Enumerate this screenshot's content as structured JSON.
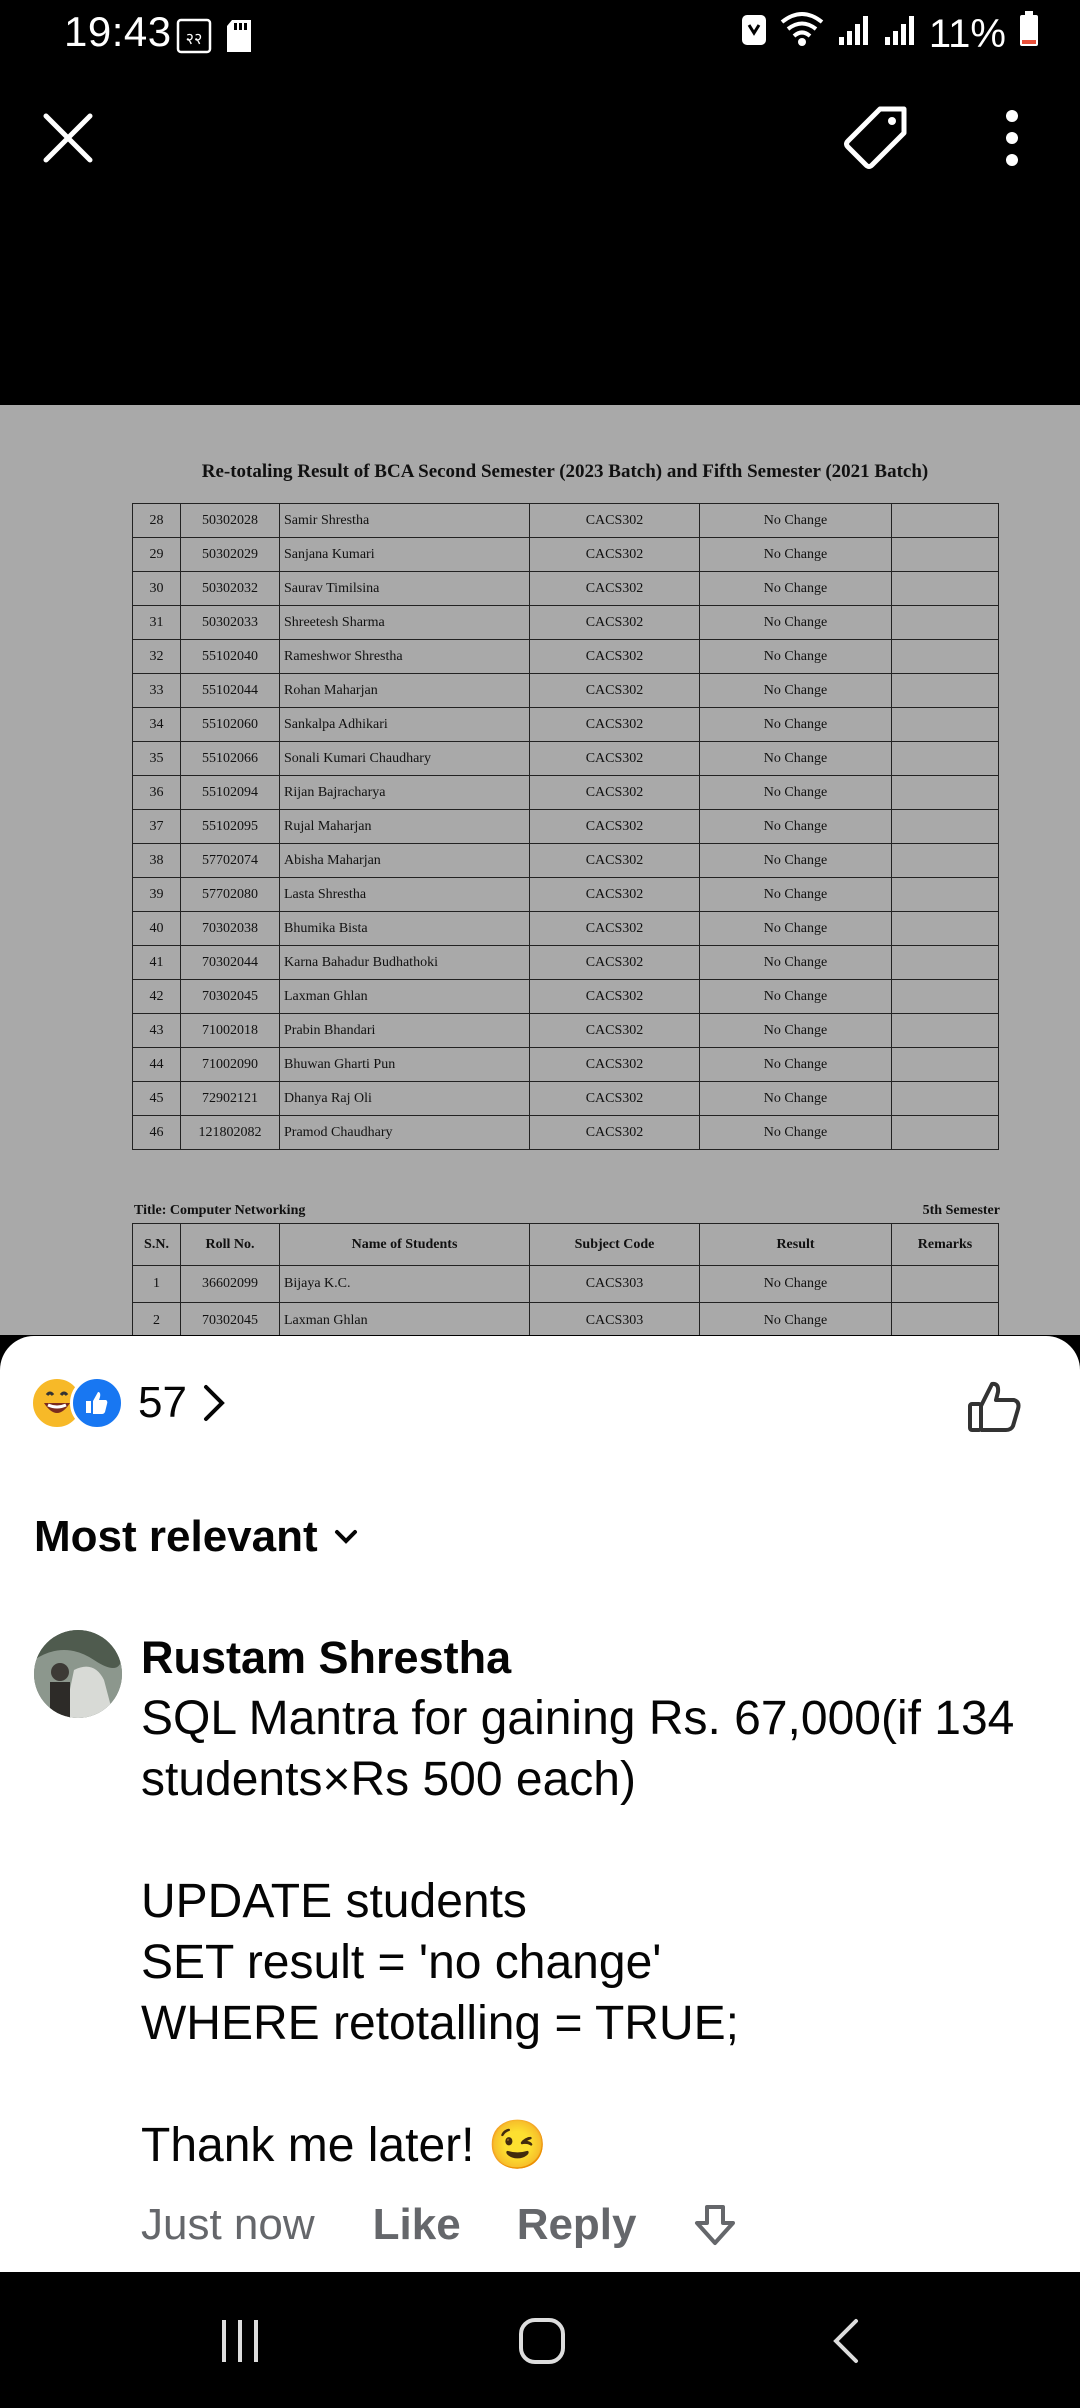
{
  "status_bar": {
    "time": "19:43",
    "notification_icons": [
      "calendar-22-icon",
      "sd-card-icon"
    ],
    "right_icons": [
      "nfc-icon",
      "wifi-icon",
      "signal-icon",
      "signal-icon"
    ],
    "battery_percent": "11%",
    "battery_level": 0.11
  },
  "top_bar": {
    "icons": [
      "close-icon",
      "tag-icon",
      "more-vert-icon"
    ]
  },
  "document": {
    "title": "Re-totaling Result of BCA Second Semester (2023 Batch) and Fifth Semester (2021 Batch)",
    "rows": [
      {
        "sn": "28",
        "roll": "50302028",
        "name": "Samir Shrestha",
        "code": "CACS302",
        "result": "No Change",
        "remarks": ""
      },
      {
        "sn": "29",
        "roll": "50302029",
        "name": "Sanjana Kumari",
        "code": "CACS302",
        "result": "No Change",
        "remarks": ""
      },
      {
        "sn": "30",
        "roll": "50302032",
        "name": "Saurav Timilsina",
        "code": "CACS302",
        "result": "No Change",
        "remarks": ""
      },
      {
        "sn": "31",
        "roll": "50302033",
        "name": "Shreetesh Sharma",
        "code": "CACS302",
        "result": "No Change",
        "remarks": ""
      },
      {
        "sn": "32",
        "roll": "55102040",
        "name": "Rameshwor Shrestha",
        "code": "CACS302",
        "result": "No Change",
        "remarks": ""
      },
      {
        "sn": "33",
        "roll": "55102044",
        "name": "Rohan Maharjan",
        "code": "CACS302",
        "result": "No Change",
        "remarks": ""
      },
      {
        "sn": "34",
        "roll": "55102060",
        "name": "Sankalpa Adhikari",
        "code": "CACS302",
        "result": "No Change",
        "remarks": ""
      },
      {
        "sn": "35",
        "roll": "55102066",
        "name": "Sonali Kumari Chaudhary",
        "code": "CACS302",
        "result": "No Change",
        "remarks": ""
      },
      {
        "sn": "36",
        "roll": "55102094",
        "name": "Rijan Bajracharya",
        "code": "CACS302",
        "result": "No Change",
        "remarks": ""
      },
      {
        "sn": "37",
        "roll": "55102095",
        "name": "Rujal Maharjan",
        "code": "CACS302",
        "result": "No Change",
        "remarks": ""
      },
      {
        "sn": "38",
        "roll": "57702074",
        "name": "Abisha Maharjan",
        "code": "CACS302",
        "result": "No Change",
        "remarks": ""
      },
      {
        "sn": "39",
        "roll": "57702080",
        "name": "Lasta Shrestha",
        "code": "CACS302",
        "result": "No Change",
        "remarks": ""
      },
      {
        "sn": "40",
        "roll": "70302038",
        "name": "Bhumika Bista",
        "code": "CACS302",
        "result": "No Change",
        "remarks": ""
      },
      {
        "sn": "41",
        "roll": "70302044",
        "name": "Karna Bahadur Budhathoki",
        "code": "CACS302",
        "result": "No Change",
        "remarks": ""
      },
      {
        "sn": "42",
        "roll": "70302045",
        "name": "Laxman Ghlan",
        "code": "CACS302",
        "result": "No Change",
        "remarks": ""
      },
      {
        "sn": "43",
        "roll": "71002018",
        "name": "Prabin Bhandari",
        "code": "CACS302",
        "result": "No Change",
        "remarks": ""
      },
      {
        "sn": "44",
        "roll": "71002090",
        "name": "Bhuwan Gharti Pun",
        "code": "CACS302",
        "result": "No Change",
        "remarks": ""
      },
      {
        "sn": "45",
        "roll": "72902121",
        "name": "Dhanya Raj Oli",
        "code": "CACS302",
        "result": "No Change",
        "remarks": ""
      },
      {
        "sn": "46",
        "roll": "121802082",
        "name": "Pramod Chaudhary",
        "code": "CACS302",
        "result": "No Change",
        "remarks": ""
      }
    ],
    "subtitle_left": "Title: Computer Networking",
    "subtitle_right": "5th Semester",
    "headers": {
      "sn": "S.N.",
      "roll": "Roll No.",
      "name": "Name of Students",
      "code": "Subject Code",
      "result": "Result",
      "remarks": "Remarks"
    },
    "rows2": [
      {
        "sn": "1",
        "roll": "36602099",
        "name": "Bijaya K.C.",
        "code": "CACS303",
        "result": "No Change",
        "remarks": ""
      },
      {
        "sn": "2",
        "roll": "70302045",
        "name": "Laxman Ghlan",
        "code": "CACS303",
        "result": "No Change",
        "remarks": ""
      }
    ]
  },
  "reactions": {
    "icons": [
      "laugh-emoji-icon",
      "like-reaction-icon"
    ],
    "count": "57",
    "like_button_icon": "thumbs-up-icon"
  },
  "sort": {
    "label": "Most relevant"
  },
  "comment": {
    "author": "Rustam Shrestha",
    "text": "SQL Mantra for gaining Rs. 67,000(if 134 students×Rs 500 each)\n\nUPDATE students\nSET result = 'no change'\nWHERE retotalling = TRUE;\n\nThank me later! 😉",
    "time": "Just now",
    "like_label": "Like",
    "reply_label": "Reply"
  },
  "nav_bar": {
    "icons": [
      "recents-icon",
      "home-icon",
      "back-icon"
    ]
  },
  "colors": {
    "photo_background": "#a9a9a9",
    "like_blue": "#1877f2",
    "secondary_text": "#65676b"
  }
}
